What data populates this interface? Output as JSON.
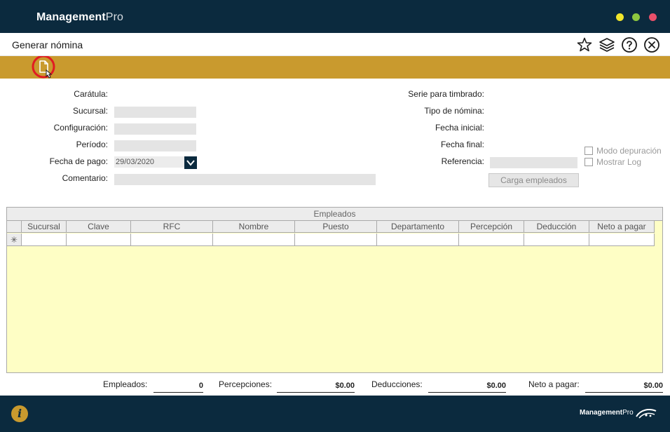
{
  "app": {
    "name_bold": "Management",
    "name_light": "Pro"
  },
  "window_controls": {
    "minimize_color": "#f1e52b",
    "maximize_color": "#8ec73f",
    "close_color": "#e8506a"
  },
  "page": {
    "title": "Generar nómina"
  },
  "header_icons": [
    "star-icon",
    "layers-icon",
    "help-icon",
    "close-icon"
  ],
  "toolbar": {
    "new_icon": "new-document-icon"
  },
  "form": {
    "caratula_label": "Carátula:",
    "sucursal_label": "Sucursal:",
    "configuracion_label": "Configuración:",
    "periodo_label": "Período:",
    "fecha_pago_label": "Fecha de pago:",
    "fecha_pago_value": "29/03/2020",
    "comentario_label": "Comentario:",
    "serie_label": "Serie para timbrado:",
    "tipo_label": "Tipo de nómina:",
    "fecha_inicial_label": "Fecha inicial:",
    "fecha_final_label": "Fecha final:",
    "referencia_label": "Referencia:",
    "modo_depuracion_label": "Modo depuración",
    "mostrar_log_label": "Mostrar Log",
    "carga_button": "Carga empleados"
  },
  "grid": {
    "title": "Empleados",
    "columns": [
      "Sucursal",
      "Clave",
      "RFC",
      "Nombre",
      "Puesto",
      "Departamento",
      "Percepción",
      "Deducción",
      "Neto a pagar"
    ],
    "new_row_marker": "✳"
  },
  "summary": {
    "empleados_label": "Empleados:",
    "empleados_value": "0",
    "percepciones_label": "Percepciones:",
    "percepciones_value": "$0.00",
    "deducciones_label": "Deducciones:",
    "deducciones_value": "$0.00",
    "neto_label": "Neto a pagar:",
    "neto_value": "$0.00"
  },
  "footer": {
    "info_icon": "i",
    "logo_bold": "Management",
    "logo_light": "Pro"
  }
}
